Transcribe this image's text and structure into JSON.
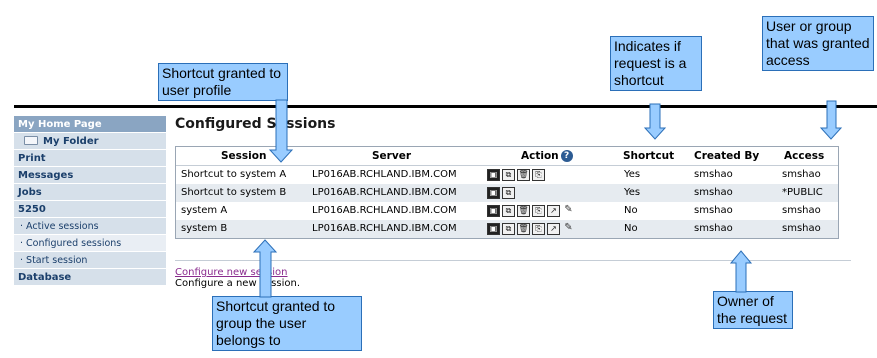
{
  "sidebar": {
    "items": [
      {
        "label": "My Home Page"
      },
      {
        "label": "My Folder"
      },
      {
        "label": "Print"
      },
      {
        "label": "Messages"
      },
      {
        "label": "Jobs"
      },
      {
        "label": "5250"
      },
      {
        "label": "· Active sessions"
      },
      {
        "label": "· Configured sessions"
      },
      {
        "label": "· Start session"
      },
      {
        "label": "Database"
      }
    ]
  },
  "main": {
    "title": "Configured Sessions",
    "table": {
      "headers": {
        "session": "Session",
        "server": "Server",
        "action": "Action",
        "help": "?",
        "shortcut": "Shortcut",
        "created_by": "Created By",
        "access": "Access"
      },
      "rows": [
        {
          "session": "Shortcut to system A",
          "server": "LP016AB.RCHLAND.IBM.COM",
          "shortcut": "Yes",
          "created_by": "smshao",
          "access": "smshao"
        },
        {
          "session": "Shortcut to system B",
          "server": "LP016AB.RCHLAND.IBM.COM",
          "shortcut": "Yes",
          "created_by": "smshao",
          "access": "*PUBLIC"
        },
        {
          "session": "system A",
          "server": "LP016AB.RCHLAND.IBM.COM",
          "shortcut": "No",
          "created_by": "smshao",
          "access": "smshao"
        },
        {
          "session": "system B",
          "server": "LP016AB.RCHLAND.IBM.COM",
          "shortcut": "No",
          "created_by": "smshao",
          "access": "smshao"
        }
      ]
    },
    "configure_link": "Configure new session",
    "configure_desc": "Configure a new session."
  },
  "callouts": {
    "user_profile": "Shortcut granted to user profile",
    "indicates": "Indicates if request is a shortcut",
    "user_group": "User or group that was granted access",
    "group": "Shortcut granted to group the user belongs to",
    "owner": "Owner of the request"
  }
}
